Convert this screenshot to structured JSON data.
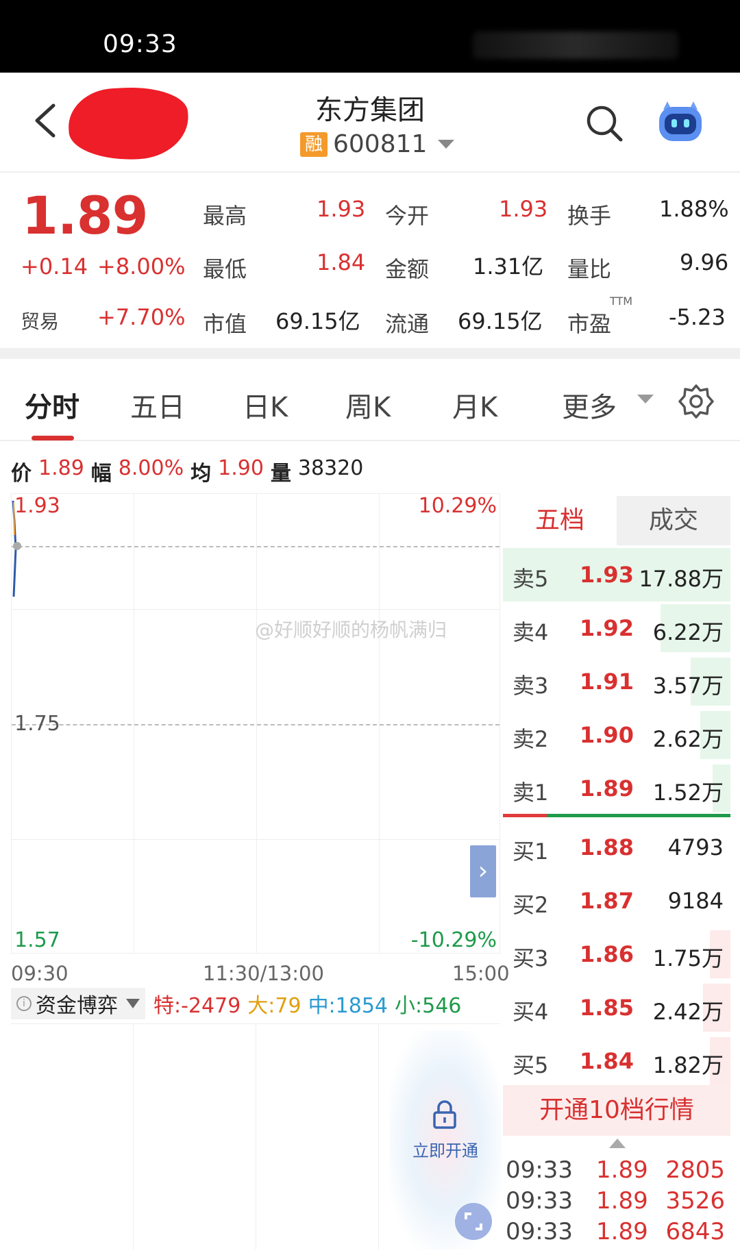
{
  "status_bar": {
    "time": "09:33"
  },
  "header": {
    "stock_name": "东方集团",
    "badge": "融",
    "code": "600811"
  },
  "quote": {
    "price": "1.89",
    "change": "+0.14",
    "change_pct": "+8.00%",
    "trade_label": "贸易",
    "trade_pct": "+7.70%",
    "high_label": "最高",
    "high": "1.93",
    "open_label": "今开",
    "open": "1.93",
    "turnover_label": "换手",
    "turnover": "1.88%",
    "low_label": "最低",
    "low": "1.84",
    "amount_label": "金额",
    "amount": "1.31亿",
    "volratio_label": "量比",
    "volratio": "9.96",
    "mktcap_label": "市值",
    "mktcap": "69.15亿",
    "float_label": "流通",
    "float": "69.15亿",
    "pe_label": "市盈",
    "pe_sup": "TTM",
    "pe": "-5.23"
  },
  "tabs": [
    "分时",
    "五日",
    "日K",
    "周K",
    "月K",
    "更多"
  ],
  "info_line": {
    "price_label": "价",
    "price": "1.89",
    "amp_label": "幅",
    "amp": "8.00%",
    "avg_label": "均",
    "avg": "1.90",
    "vol_label": "量",
    "vol": "38320"
  },
  "chart": {
    "y_top": "1.93",
    "y_mid": "1.75",
    "y_bot": "1.57",
    "pct_top": "10.29%",
    "pct_bot": "-10.29%",
    "x_start": "09:30",
    "x_mid": "11:30/13:00",
    "x_end": "15:00",
    "watermark": "@好顺好顺的杨帆满归"
  },
  "fund": {
    "title": "资金博弈",
    "te": "特:-2479",
    "da": "大:79",
    "zhong": "中:1854",
    "xiao": "小:546",
    "unlock": "立即开通"
  },
  "panel": {
    "tab_active": "五档",
    "tab_other": "成交",
    "asks": [
      {
        "name": "卖5",
        "price": "1.93",
        "vol": "17.88万"
      },
      {
        "name": "卖4",
        "price": "1.92",
        "vol": "6.22万"
      },
      {
        "name": "卖3",
        "price": "1.91",
        "vol": "3.57万"
      },
      {
        "name": "卖2",
        "price": "1.90",
        "vol": "2.62万"
      },
      {
        "name": "卖1",
        "price": "1.89",
        "vol": "1.52万"
      }
    ],
    "bids": [
      {
        "name": "买1",
        "price": "1.88",
        "vol": "4793"
      },
      {
        "name": "买2",
        "price": "1.87",
        "vol": "9184"
      },
      {
        "name": "买3",
        "price": "1.86",
        "vol": "1.75万"
      },
      {
        "name": "买4",
        "price": "1.85",
        "vol": "2.42万"
      },
      {
        "name": "买5",
        "price": "1.84",
        "vol": "1.82万"
      }
    ],
    "open10": "开通10档行情",
    "trades": [
      {
        "time": "09:33",
        "price": "1.89",
        "vol": "2805"
      },
      {
        "time": "09:33",
        "price": "1.89",
        "vol": "3526"
      },
      {
        "time": "09:33",
        "price": "1.89",
        "vol": "6843"
      }
    ]
  }
}
